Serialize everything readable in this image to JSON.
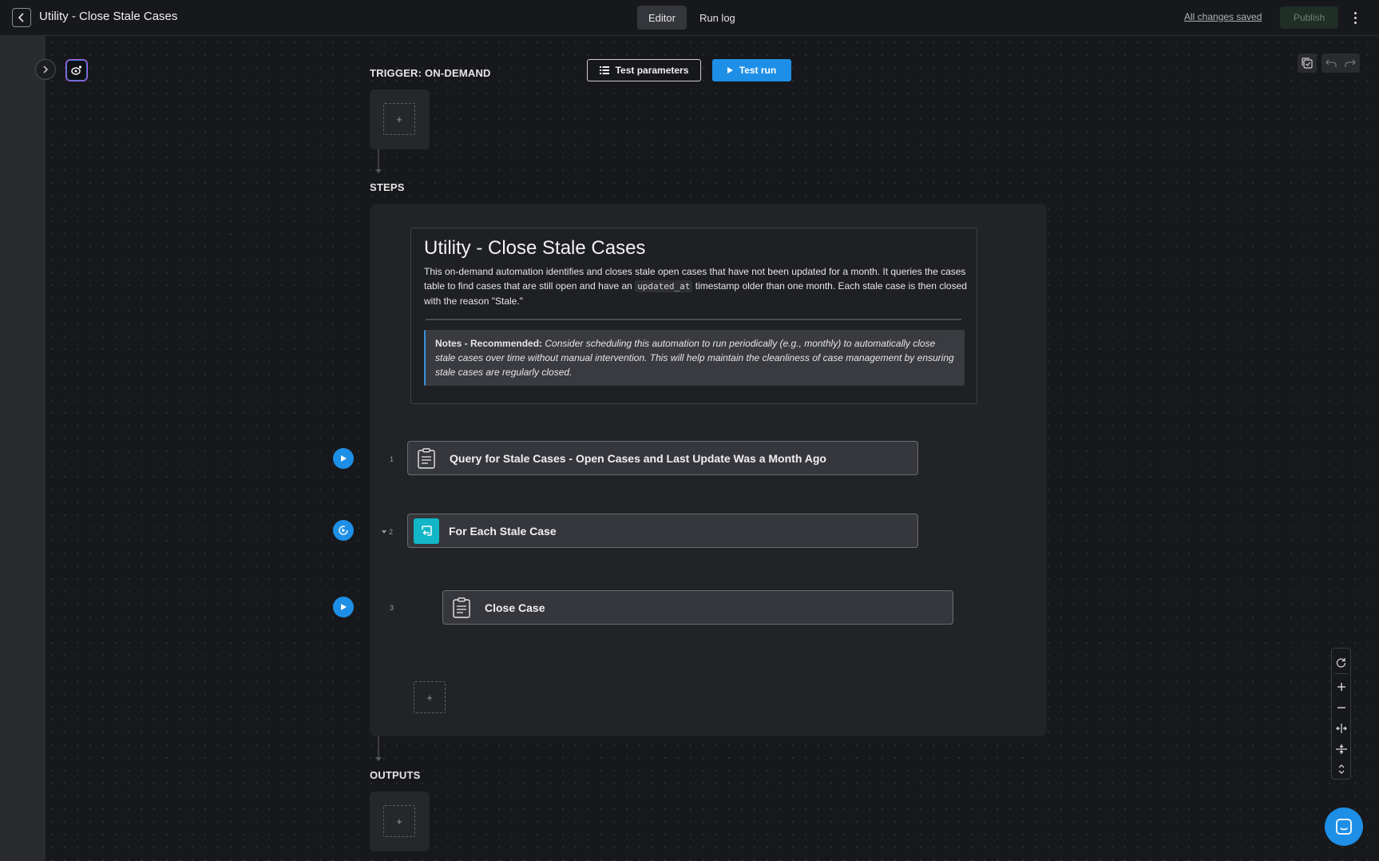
{
  "header": {
    "title": "Utility - Close Stale Cases",
    "tabs": [
      {
        "label": "Editor",
        "active": true
      },
      {
        "label": "Run log",
        "active": false
      }
    ],
    "saved_status": "All changes saved",
    "publish_label": "Publish"
  },
  "canvas": {
    "trigger_label": "TRIGGER: ON-DEMAND",
    "test_parameters_label": "Test parameters",
    "test_run_label": "Test run",
    "steps_label": "STEPS",
    "outputs_label": "OUTPUTS",
    "add_symbol": "+"
  },
  "note": {
    "title": "Utility - Close Stale Cases",
    "desc_before": "This on-demand automation identifies and closes stale open cases that have not been updated for a month. It queries the cases table to find cases that are still open and have an ",
    "desc_code": "updated_at",
    "desc_after": " timestamp older than one month. Each stale case is then closed with the reason \"Stale.\"",
    "callout_bold": "Notes - Recommended:",
    "callout_text": " Consider scheduling this automation to run periodically (e.g., monthly) to automatically close stale cases over time without manual intervention. This will help maintain the cleanliness of case management by ensuring stale cases are regularly closed."
  },
  "steps": [
    {
      "number": "1",
      "label": "Query for Stale Cases - Open Cases and Last Update Was a Month Ago",
      "icon": "document-list-icon"
    },
    {
      "number": "2",
      "label": "For Each Stale Case",
      "icon": "loop-icon"
    },
    {
      "number": "3",
      "label": "Close Case",
      "icon": "document-list-icon"
    }
  ],
  "colors": {
    "accent": "#1e8fe6",
    "loop_icon_bg": "#12b6c6",
    "background": "#17181b"
  }
}
